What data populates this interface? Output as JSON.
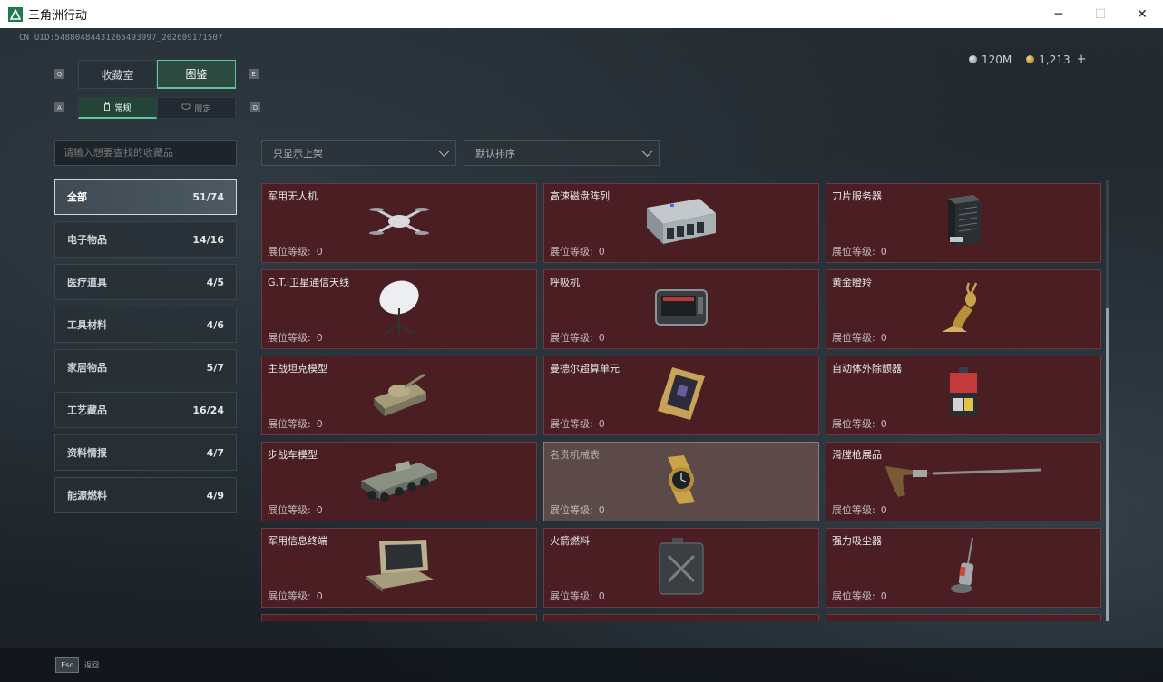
{
  "window": {
    "title": "三角洲行动",
    "minimize": "─",
    "maximize": "☐",
    "close": "✕"
  },
  "uid": "CN UID:54880484431265493997_202609171507",
  "currency": {
    "silver": "120M",
    "gold": "1,213",
    "plus": "+"
  },
  "keyhints": {
    "q": "Q",
    "e": "E",
    "a": "A",
    "d": "D"
  },
  "tabs": [
    {
      "label": "收藏室"
    },
    {
      "label": "图鉴"
    }
  ],
  "subtabs": [
    {
      "label": "常规"
    },
    {
      "label": "限定"
    }
  ],
  "search": {
    "placeholder": "请输入想要查找的收藏品"
  },
  "filters": {
    "shelf": "只显示上架",
    "sort": "默认排序"
  },
  "categories": [
    {
      "name": "全部",
      "count": "51/74"
    },
    {
      "name": "电子物品",
      "count": "14/16"
    },
    {
      "name": "医疗道具",
      "count": "4/5"
    },
    {
      "name": "工具材料",
      "count": "4/6"
    },
    {
      "name": "家居物品",
      "count": "5/7"
    },
    {
      "name": "工艺藏品",
      "count": "16/24"
    },
    {
      "name": "资料情报",
      "count": "4/7"
    },
    {
      "name": "能源燃料",
      "count": "4/9"
    }
  ],
  "level_label": "展位等级:",
  "items": [
    {
      "name": "军用无人机",
      "level": "0",
      "icon": "drone"
    },
    {
      "name": "高速磁盘阵列",
      "level": "0",
      "icon": "disk-array"
    },
    {
      "name": "刀片服务器",
      "level": "0",
      "icon": "blade-server"
    },
    {
      "name": "G.T.I卫星通信天线",
      "level": "0",
      "icon": "satellite-dish"
    },
    {
      "name": "呼吸机",
      "level": "0",
      "icon": "ventilator"
    },
    {
      "name": "黄金瞪羚",
      "level": "0",
      "icon": "golden-gazelle"
    },
    {
      "name": "主战坦克模型",
      "level": "0",
      "icon": "tank-model"
    },
    {
      "name": "曼德尔超算单元",
      "level": "0",
      "icon": "supercomputer-unit"
    },
    {
      "name": "自动体外除颤器",
      "level": "0",
      "icon": "defibrillator"
    },
    {
      "name": "步战车模型",
      "level": "0",
      "icon": "ifv-model"
    },
    {
      "name": "名贵机械表",
      "level": "0",
      "icon": "luxury-watch"
    },
    {
      "name": "滑膛枪展品",
      "level": "0",
      "icon": "musket"
    },
    {
      "name": "军用信息终端",
      "level": "0",
      "icon": "military-terminal"
    },
    {
      "name": "火箭燃料",
      "level": "0",
      "icon": "rocket-fuel"
    },
    {
      "name": "强力吸尘器",
      "level": "0",
      "icon": "vacuum-cleaner"
    }
  ],
  "bottom": {
    "esc_key": "Esc",
    "esc_label": "返回"
  },
  "colors": {
    "accent": "#5fc79c",
    "card_bg": "#4a1e22",
    "card_highlight": "#5c4a49"
  }
}
